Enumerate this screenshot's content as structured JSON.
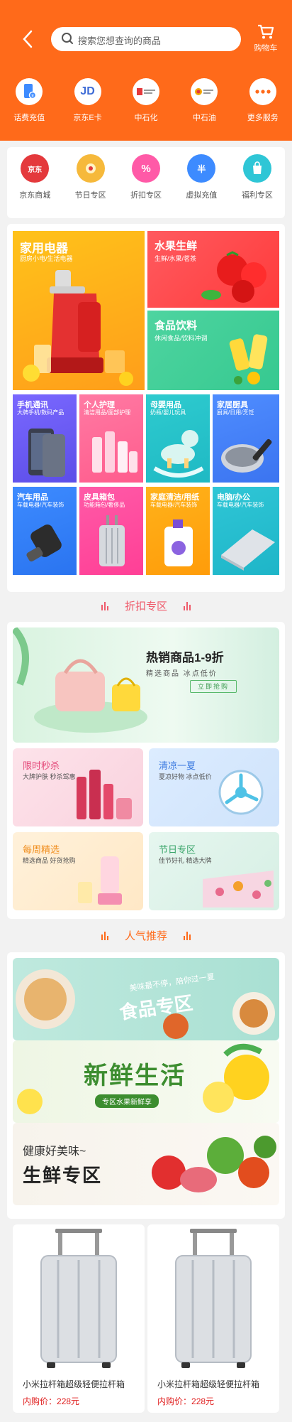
{
  "header": {
    "search_placeholder": "搜索您想查询的商品",
    "cart_label": "购物车"
  },
  "top_services": [
    {
      "label": "话费充值",
      "icon": "phone-icon"
    },
    {
      "label": "京东E卡",
      "icon": "jd-logo",
      "logo_text": "JD"
    },
    {
      "label": "中石化",
      "icon": "sinopec-logo"
    },
    {
      "label": "中石油",
      "icon": "petrochina-logo"
    },
    {
      "label": "更多服务",
      "icon": "more-icon"
    }
  ],
  "categories": [
    {
      "label": "京东商城",
      "color": "#e4393c",
      "logo_text": "京东"
    },
    {
      "label": "节日专区",
      "color": "#f6b93b"
    },
    {
      "label": "折扣专区",
      "color": "#ff5aa7",
      "glyph": "%"
    },
    {
      "label": "虚拟充值",
      "color": "#3d8bff",
      "glyph": "半"
    },
    {
      "label": "福利专区",
      "color": "#2fc6d6"
    }
  ],
  "tiles": {
    "appliance": {
      "title": "家用电器",
      "sub": "厨房小电/生活电器"
    },
    "fruit": {
      "title": "水果生鲜",
      "sub": "生鲜/水果/茗茶"
    },
    "food": {
      "title": "食品饮料",
      "sub": "休闲食品/饮料冲调"
    },
    "small": [
      {
        "title": "手机通讯",
        "sub": "大牌手机/数码产品"
      },
      {
        "title": "个人护理",
        "sub": "清洁用品/面部护理"
      },
      {
        "title": "母婴用品",
        "sub": "奶瓶/婴儿玩具"
      },
      {
        "title": "家居厨具",
        "sub": "厨具/日用/烹饪"
      },
      {
        "title": "汽车用品",
        "sub": "车载电器/汽车装饰"
      },
      {
        "title": "皮具箱包",
        "sub": "功能箱包/奢侈品"
      },
      {
        "title": "家庭清洁/用纸",
        "sub": "车载电器/汽车装饰"
      },
      {
        "title": "电脑/办公",
        "sub": "车载电器/汽车装饰"
      }
    ]
  },
  "discount_section": {
    "title": "折扣专区",
    "banner_title": "热销商品1-9折",
    "banner_sub": "精选商品 冰点低价",
    "banner_button": "立即抢购",
    "cards": [
      {
        "title": "限时秒杀",
        "sub": "大牌护肤 秒杀驾惠"
      },
      {
        "title": "清凉一夏",
        "sub": "夏凉好物 冰点低价"
      },
      {
        "title": "每周精选",
        "sub": "精选商品 好货抢购"
      },
      {
        "title": "节日专区",
        "sub": "佳节好礼 精选大牌"
      }
    ]
  },
  "popular_section": {
    "title": "人气推荐",
    "banners": [
      {
        "title": "食品专区",
        "sub": "美味最不停，陪你过一夏"
      },
      {
        "title": "新鲜生活",
        "sub": "专区水果新鲜享"
      },
      {
        "title": "生鲜专区",
        "sub": "健康好美味~"
      }
    ]
  },
  "products": [
    {
      "name": "小米拉杆箱超级轻便拉杆箱",
      "price_label": "内购价：",
      "price": "228元"
    },
    {
      "name": "小米拉杆箱超级轻便拉杆箱",
      "price_label": "内购价：",
      "price": "228元"
    }
  ]
}
